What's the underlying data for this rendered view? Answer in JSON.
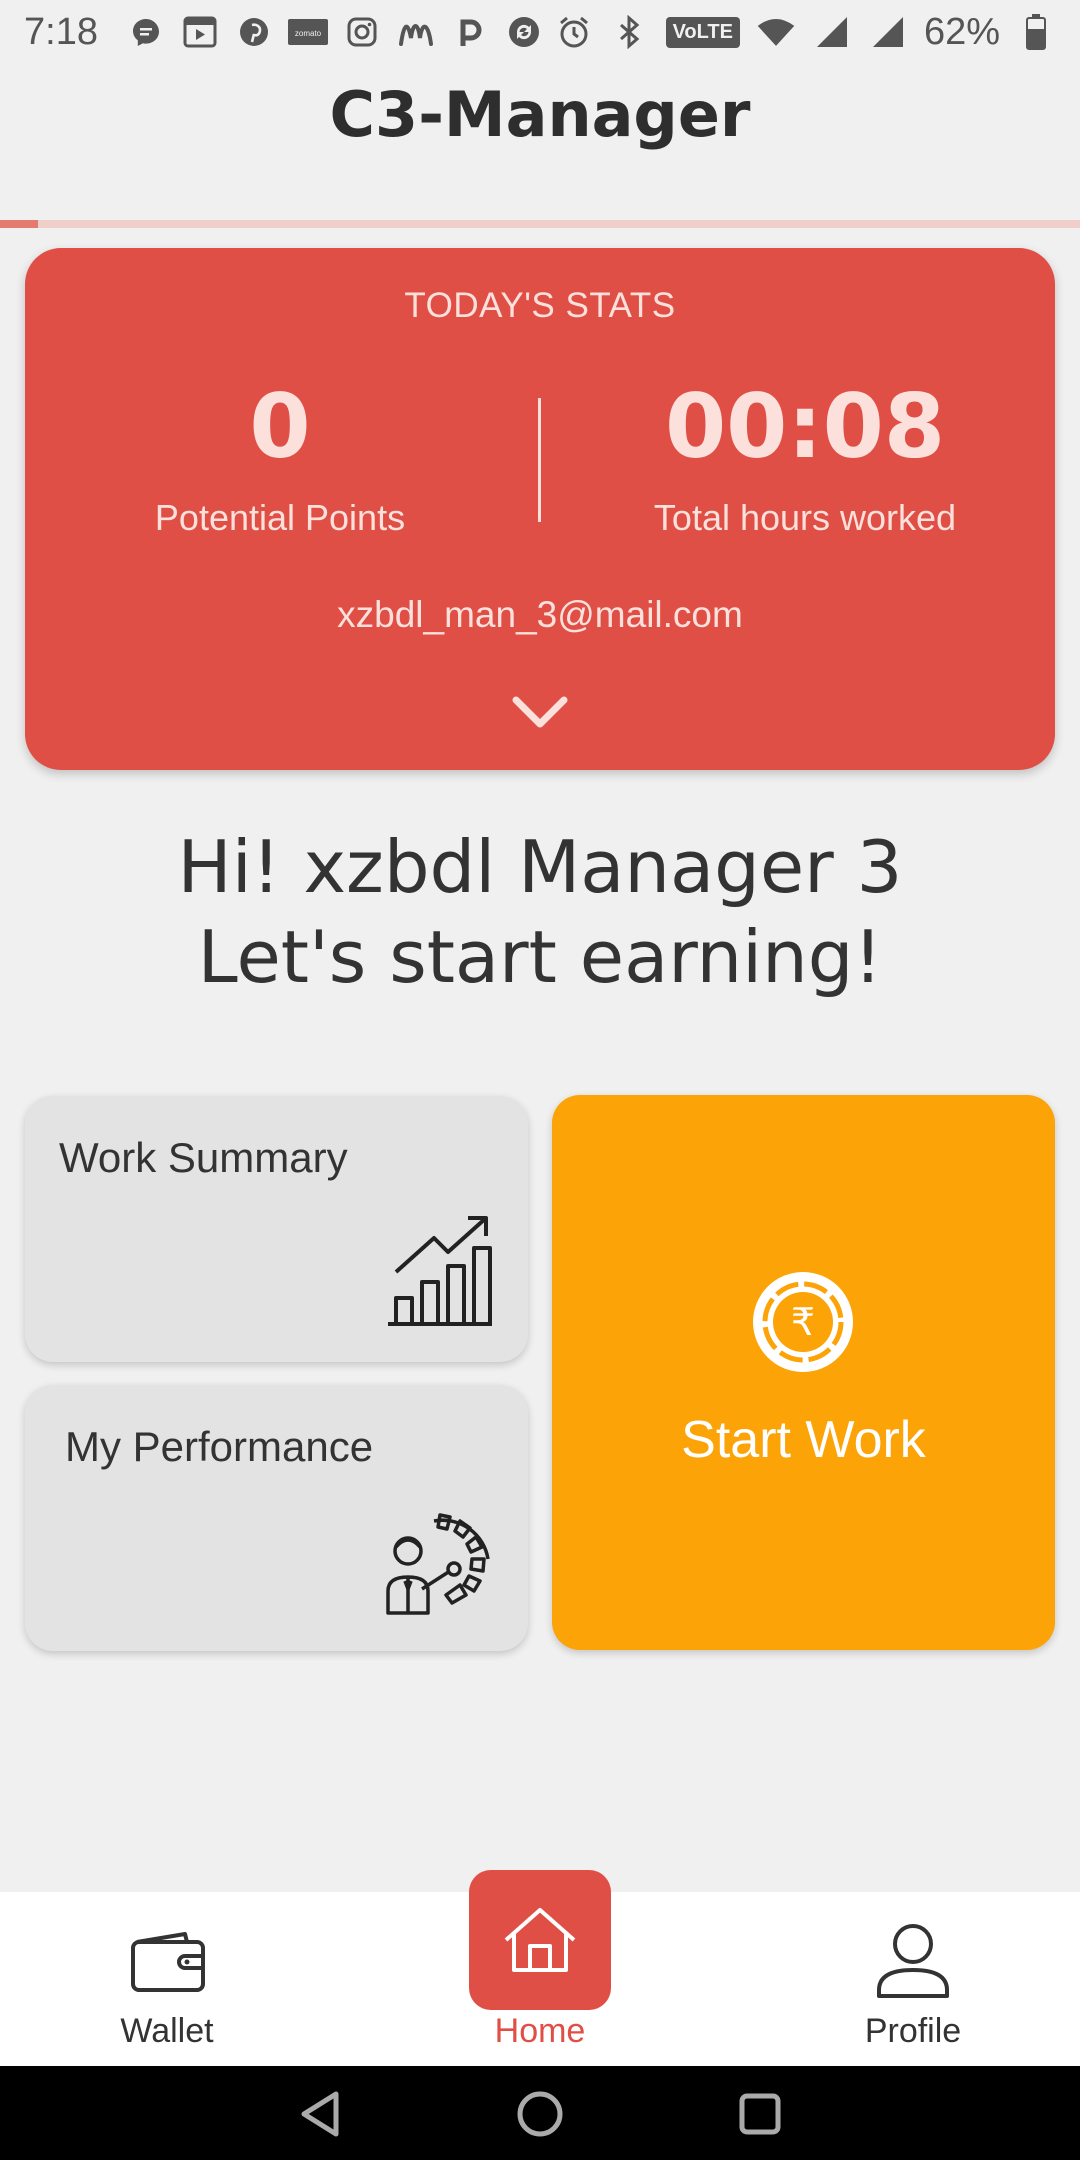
{
  "status_bar": {
    "time": "7:18",
    "battery": "62%",
    "network_badge": "VoLTE",
    "notification_icons": [
      "messenger-icon",
      "youtube-icon",
      "pinterest-icon",
      "zomato-icon",
      "instagram-icon",
      "meesho-icon",
      "paytm-icon",
      "sync-icon"
    ],
    "zomato_text": "zomato"
  },
  "app": {
    "title": "C3-Manager",
    "progress_fraction": 0.035
  },
  "stats": {
    "heading": "TODAY'S STATS",
    "points_value": "0",
    "points_label": "Potential Points",
    "hours_value": "00:08",
    "hours_label": "Total hours worked",
    "email": "xzbdl_man_3@mail.com"
  },
  "greeting": {
    "line1": "Hi! xzbdl Manager 3",
    "line2": "Let's start earning!"
  },
  "tiles": {
    "work_summary": "Work Summary",
    "my_performance": "My Performance",
    "start_work": "Start Work"
  },
  "nav": {
    "wallet": "Wallet",
    "home": "Home",
    "profile": "Profile",
    "active": "home"
  },
  "colors": {
    "primary": "#e04f45",
    "accent": "#fba307",
    "background": "#f0f0f0",
    "tile": "#e4e3e3"
  }
}
